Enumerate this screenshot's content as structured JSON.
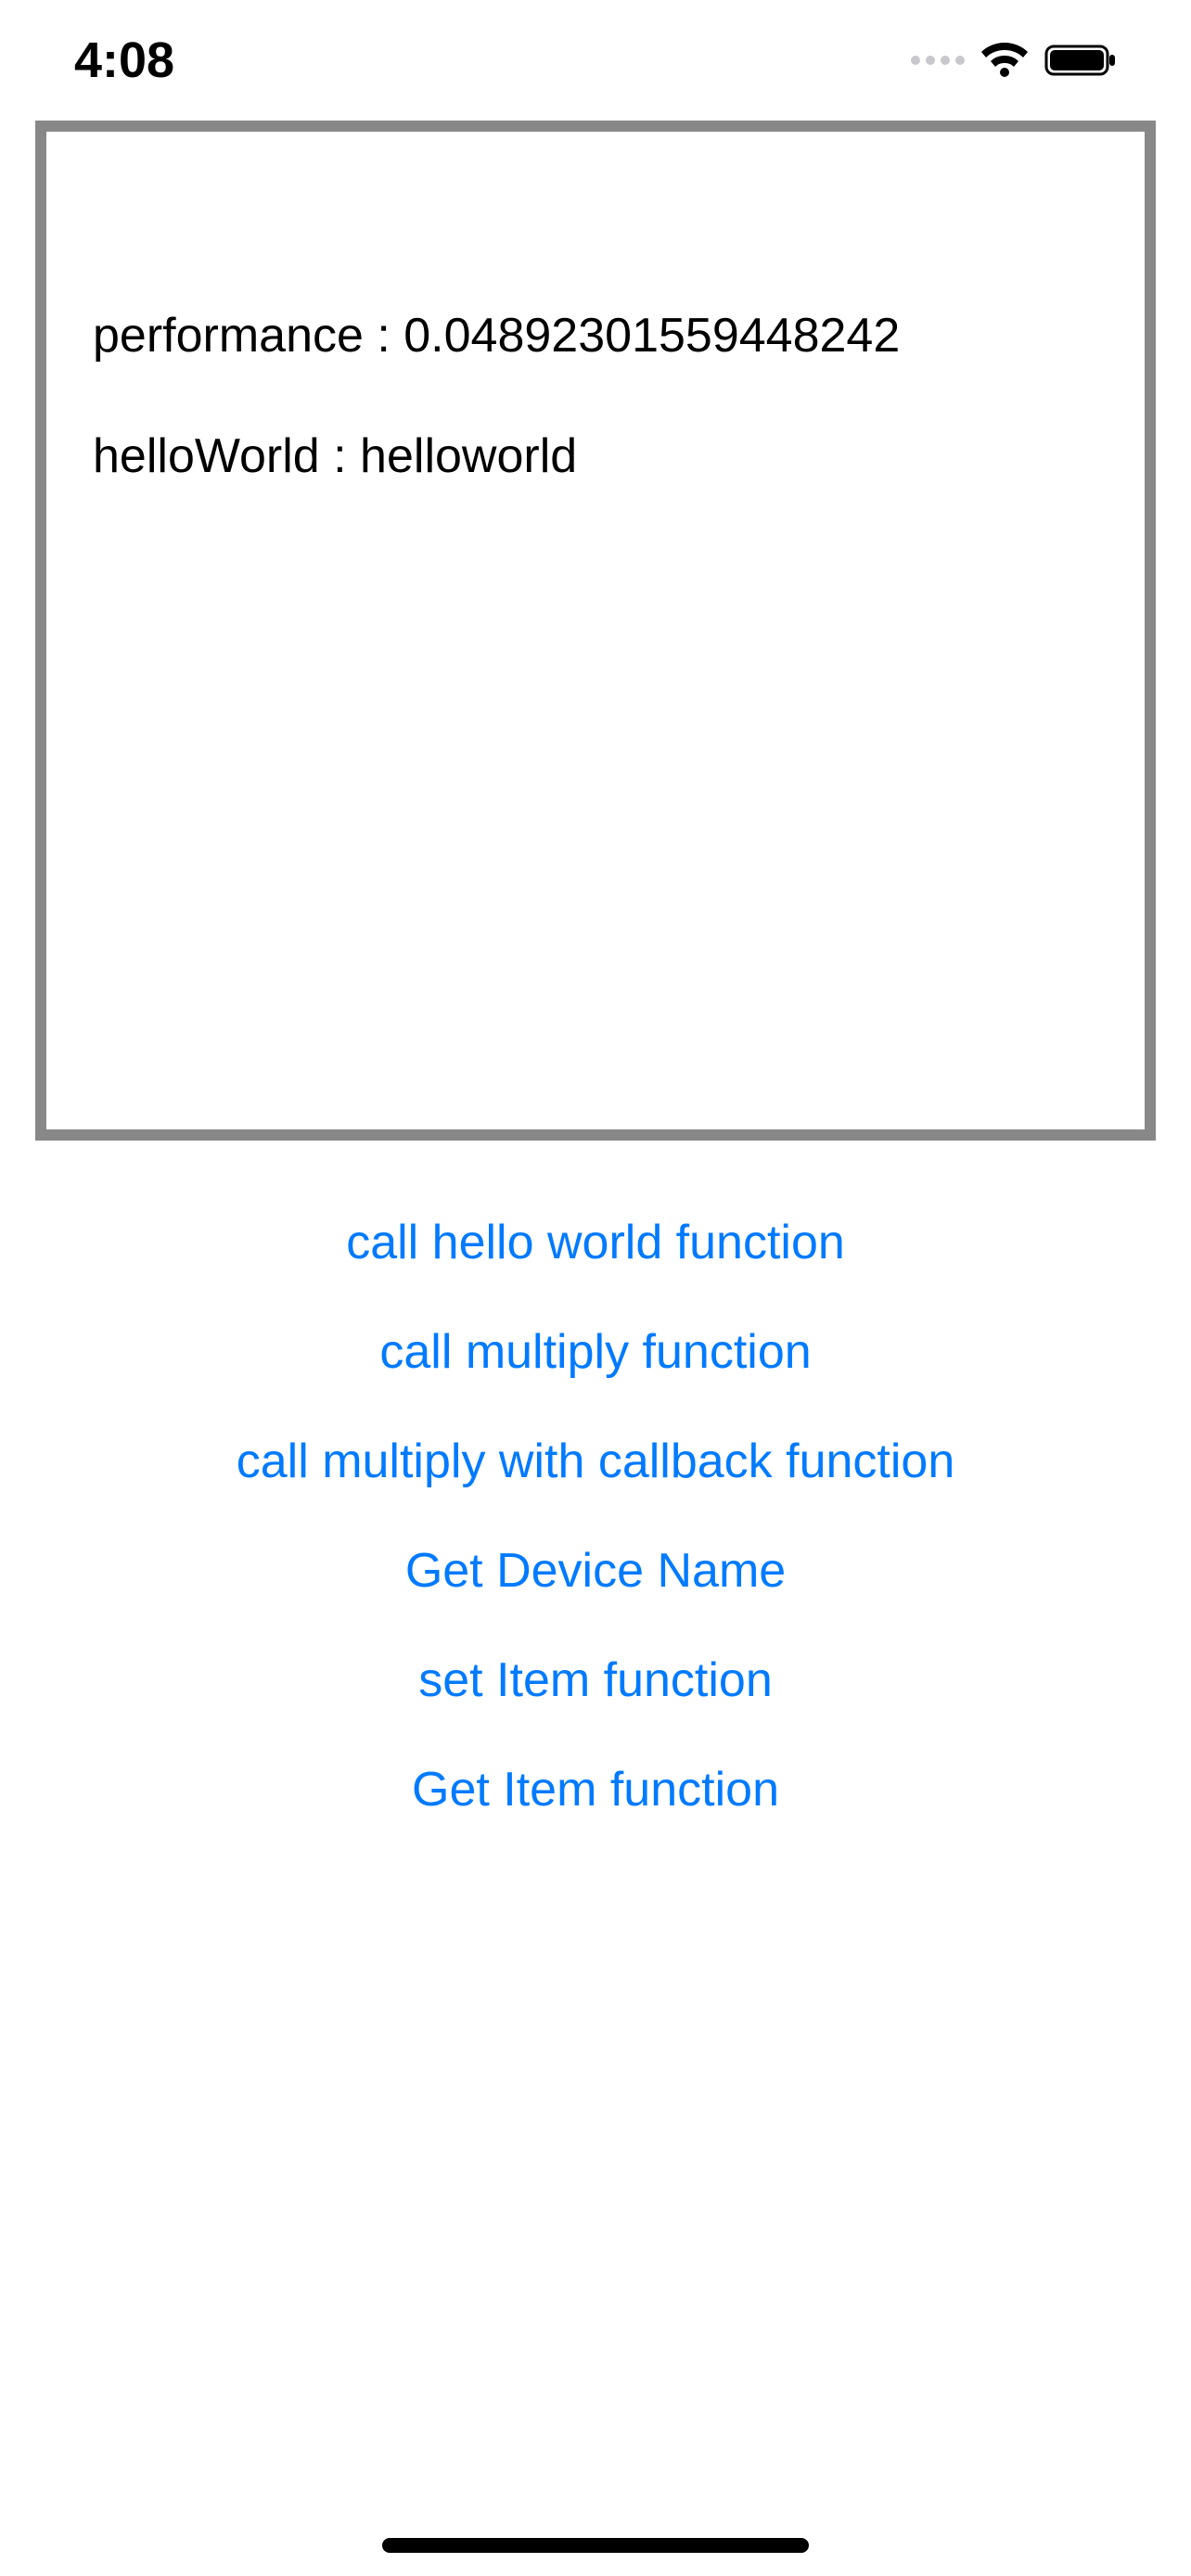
{
  "statusBar": {
    "time": "4:08"
  },
  "output": {
    "performanceLine": "performance : 0.04892301559448242",
    "helloWorldLine": "helloWorld : helloworld"
  },
  "buttons": {
    "callHelloWorld": "call hello world function",
    "callMultiply": "call multiply function",
    "callMultiplyCallback": "call multiply with callback function",
    "getDeviceName": "Get Device Name",
    "setItem": "set Item function",
    "getItem": "Get Item function"
  }
}
